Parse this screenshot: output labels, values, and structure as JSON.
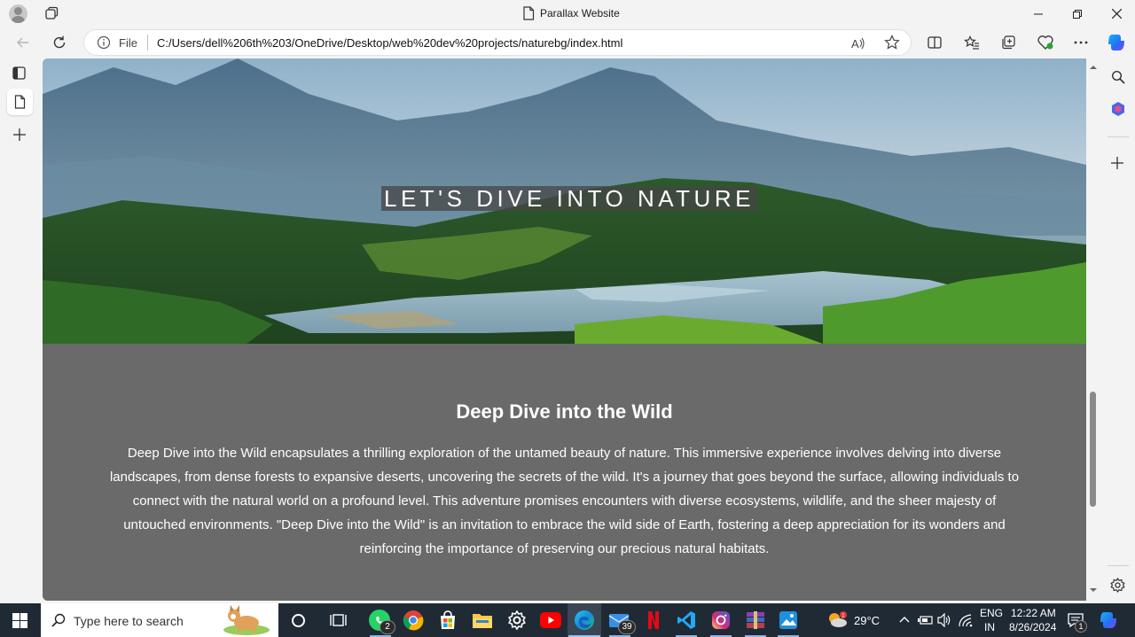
{
  "window": {
    "title": "Parallax Website"
  },
  "address_bar": {
    "scheme_label": "File",
    "url": "C:/Users/dell%206th%203/OneDrive/Desktop/web%20dev%20projects/naturebg/index.html"
  },
  "page": {
    "hero_title": "LET'S DIVE INTO NATURE",
    "section_heading": "Deep Dive into the Wild",
    "section_text": "Deep Dive into the Wild encapsulates a thrilling exploration of the untamed beauty of nature. This immersive experience involves delving into diverse landscapes, from dense forests to expansive deserts, uncovering the secrets of the wild. It's a journey that goes beyond the surface, allowing individuals to connect with the natural world on a profound level. This adventure promises encounters with diverse ecosystems, wildlife, and the sheer majesty of untouched environments. \"Deep Dive into the Wild\" is an invitation to embrace the wild side of Earth, fostering a deep appreciation for its wonders and reinforcing the importance of preserving our precious natural habitats."
  },
  "taskbar": {
    "search_placeholder": "Type here to search",
    "whatsapp_badge": "2",
    "mail_badge": "39",
    "weather_temp": "29°C",
    "language_line1": "ENG",
    "language_line2": "IN",
    "time": "12:22 AM",
    "date": "8/26/2024",
    "notification_badge": "1"
  },
  "icons": {
    "accent": "#0b6cbd",
    "taskbar_bg": "#202a35"
  }
}
